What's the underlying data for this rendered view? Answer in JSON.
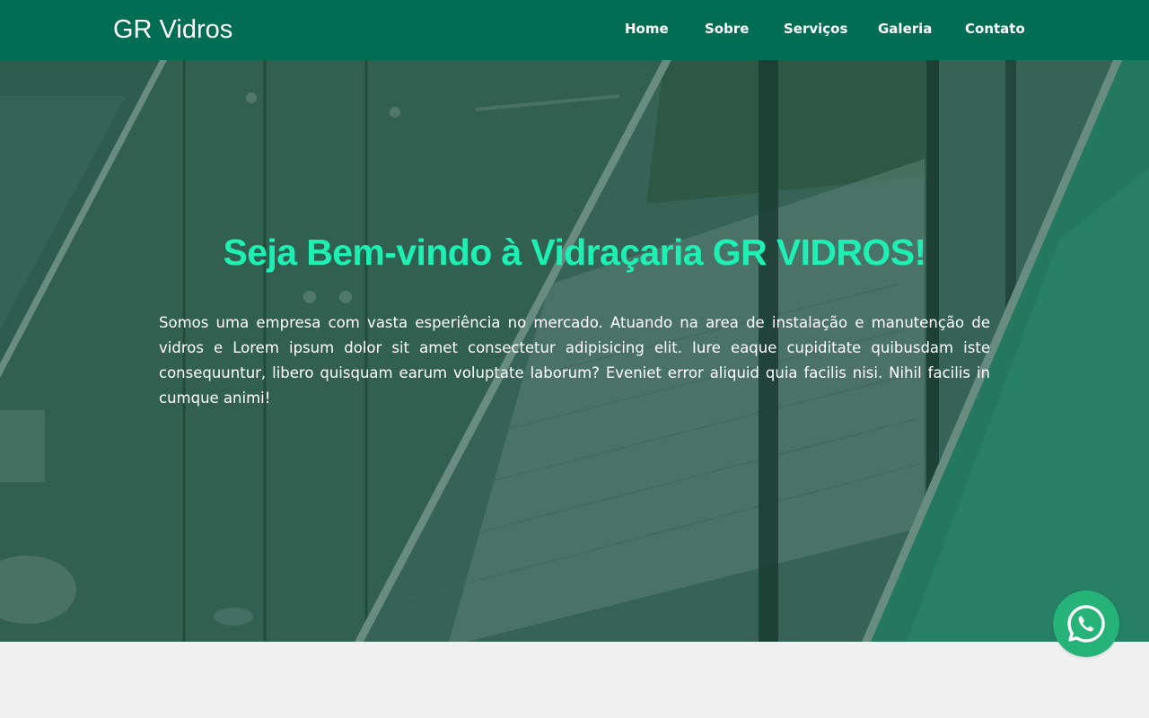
{
  "navbar": {
    "brand": "GR Vidros",
    "links": [
      "Home",
      "Sobre",
      "Serviços",
      "Galeria",
      "Contato"
    ]
  },
  "hero": {
    "title": "Seja Bem-vindo à Vidraçaria GR VIDROS!",
    "text": "Somos uma empresa com vasta esperiência no mercado. Atuando na area de instalação e manutenção de vidros e Lorem ipsum dolor sit amet consectetur adipisicing elit. Iure eaque cupiditate quibusdam iste consequuntur, libero quisquam earum voluptate laborum? Eveniet error aliquid quia facilis nisi. Nihil facilis in cumque animi!"
  },
  "floating": {
    "icon": "whatsapp-icon"
  },
  "colors": {
    "navbar": "#016d52",
    "title": "#1ef0b4",
    "whatsapp": "#25b37a",
    "page_bg": "#f0f0f0"
  }
}
